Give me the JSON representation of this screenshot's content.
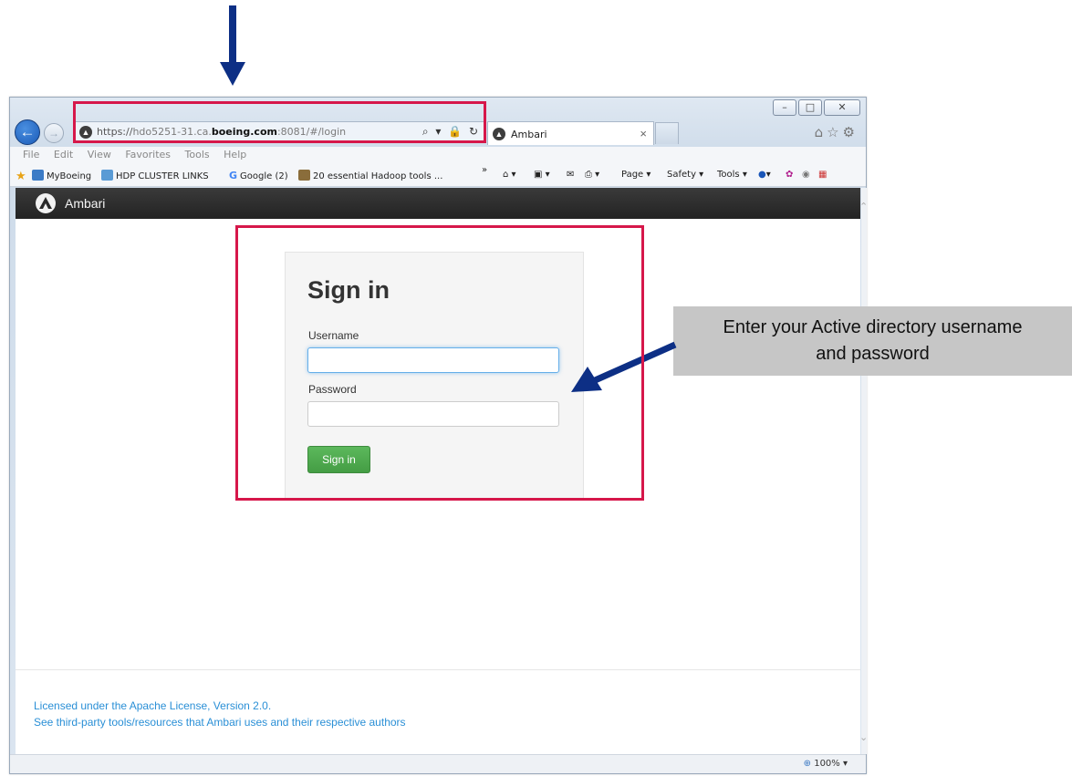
{
  "browser": {
    "url_prefix": "https://",
    "url_host_pre": "hdo5251-31.ca.",
    "url_host_bold": "boeing.com",
    "url_path": ":8081/#/login",
    "url_tools": "⌕ ▾ 🔒 ↻",
    "tab_title": "Ambari",
    "tab_close": "×",
    "menu": [
      "File",
      "Edit",
      "View",
      "Favorites",
      "Tools",
      "Help"
    ],
    "favorites": [
      {
        "label": "MyBoeing",
        "color": "#3b7bc6"
      },
      {
        "label": "HDP CLUSTER LINKS",
        "color": "#5a9bd5"
      },
      {
        "label": "Google (2)",
        "color": ""
      },
      {
        "label": "20 essential Hadoop tools ...",
        "color": "#8a6d3b"
      }
    ],
    "command_bar": [
      "Page ▾",
      "Safety ▾",
      "Tools ▾"
    ],
    "zoom": "100%"
  },
  "app": {
    "name": "Ambari"
  },
  "signin": {
    "title": "Sign in",
    "username_label": "Username",
    "username_value": "",
    "password_label": "Password",
    "password_value": "",
    "button_label": "Sign in"
  },
  "footer": {
    "license": "Licensed under the Apache License, Version 2.0.",
    "third_party": "See third-party tools/resources that Ambari uses and their respective authors"
  },
  "annotation": {
    "callout_line1": "Enter your Active directory username",
    "callout_line2": "and password",
    "highlight_color": "#d6174a",
    "arrow_color": "#0d2f85"
  }
}
